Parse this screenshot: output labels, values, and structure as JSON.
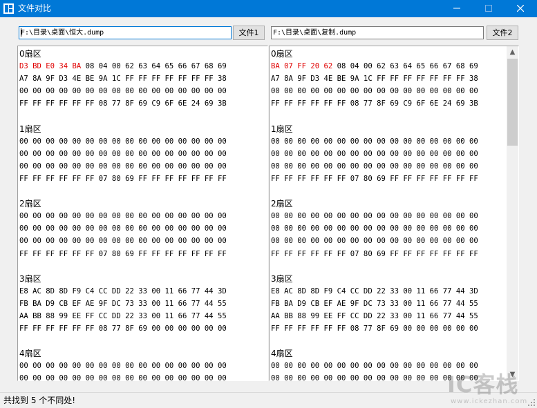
{
  "window": {
    "title": "文件对比",
    "minimize": "—",
    "maximize": "☐",
    "close": "✕"
  },
  "file1": {
    "path": "F:\\目录\\桌面\\恒大.dump",
    "button_label": "文件1"
  },
  "file2": {
    "path": "F:\\目录\\桌面\\复制.dump",
    "button_label": "文件2"
  },
  "left_pane": [
    {
      "text": "0扇区",
      "header": true
    },
    {
      "diff": "D3 BD E0 34 BA",
      "text": " 08 04 00 62 63 64 65 66 67 68 69"
    },
    {
      "text": "A7 8A 9F D3 4E BE 9A 1C FF FF FF FF FF FF FF 38"
    },
    {
      "text": "00 00 00 00 00 00 00 00 00 00 00 00 00 00 00 00"
    },
    {
      "text": "FF FF FF FF FF FF 08 77 8F 69 C9 6F 6E 24 69 3B"
    },
    {
      "text": ""
    },
    {
      "text": "1扇区",
      "header": true
    },
    {
      "text": "00 00 00 00 00 00 00 00 00 00 00 00 00 00 00 00"
    },
    {
      "text": "00 00 00 00 00 00 00 00 00 00 00 00 00 00 00 00"
    },
    {
      "text": "00 00 00 00 00 00 00 00 00 00 00 00 00 00 00 00"
    },
    {
      "text": "FF FF FF FF FF FF 07 80 69 FF FF FF FF FF FF FF"
    },
    {
      "text": ""
    },
    {
      "text": "2扇区",
      "header": true
    },
    {
      "text": "00 00 00 00 00 00 00 00 00 00 00 00 00 00 00 00"
    },
    {
      "text": "00 00 00 00 00 00 00 00 00 00 00 00 00 00 00 00"
    },
    {
      "text": "00 00 00 00 00 00 00 00 00 00 00 00 00 00 00 00"
    },
    {
      "text": "FF FF FF FF FF FF 07 80 69 FF FF FF FF FF FF FF"
    },
    {
      "text": ""
    },
    {
      "text": "3扇区",
      "header": true
    },
    {
      "text": "E8 AC 8D 8D F9 C4 CC DD 22 33 00 11 66 77 44 3D"
    },
    {
      "text": "FB BA D9 CB EF AE 9F DC 73 33 00 11 66 77 44 55"
    },
    {
      "text": "AA BB 88 99 EE FF CC DD 22 33 00 11 66 77 44 55"
    },
    {
      "text": "FF FF FF FF FF FF 08 77 8F 69 00 00 00 00 00 00"
    },
    {
      "text": ""
    },
    {
      "text": "4扇区",
      "header": true
    },
    {
      "text": "00 00 00 00 00 00 00 00 00 00 00 00 00 00 00 00"
    },
    {
      "text": "00 00 00 00 00 00 00 00 00 00 00 00 00 00 00 00"
    }
  ],
  "right_pane": [
    {
      "text": "0扇区",
      "header": true
    },
    {
      "diff": "BA 07 FF 20 62",
      "text": " 08 04 00 62 63 64 65 66 67 68 69"
    },
    {
      "text": "A7 8A 9F D3 4E BE 9A 1C FF FF FF FF FF FF FF 38"
    },
    {
      "text": "00 00 00 00 00 00 00 00 00 00 00 00 00 00 00 00"
    },
    {
      "text": "FF FF FF FF FF FF 08 77 8F 69 C9 6F 6E 24 69 3B"
    },
    {
      "text": ""
    },
    {
      "text": "1扇区",
      "header": true
    },
    {
      "text": "00 00 00 00 00 00 00 00 00 00 00 00 00 00 00 00"
    },
    {
      "text": "00 00 00 00 00 00 00 00 00 00 00 00 00 00 00 00"
    },
    {
      "text": "00 00 00 00 00 00 00 00 00 00 00 00 00 00 00 00"
    },
    {
      "text": "FF FF FF FF FF FF 07 80 69 FF FF FF FF FF FF FF"
    },
    {
      "text": ""
    },
    {
      "text": "2扇区",
      "header": true
    },
    {
      "text": "00 00 00 00 00 00 00 00 00 00 00 00 00 00 00 00"
    },
    {
      "text": "00 00 00 00 00 00 00 00 00 00 00 00 00 00 00 00"
    },
    {
      "text": "00 00 00 00 00 00 00 00 00 00 00 00 00 00 00 00"
    },
    {
      "text": "FF FF FF FF FF FF 07 80 69 FF FF FF FF FF FF FF"
    },
    {
      "text": ""
    },
    {
      "text": "3扇区",
      "header": true
    },
    {
      "text": "E8 AC 8D 8D F9 C4 CC DD 22 33 00 11 66 77 44 3D"
    },
    {
      "text": "FB BA D9 CB EF AE 9F DC 73 33 00 11 66 77 44 55"
    },
    {
      "text": "AA BB 88 99 EE FF CC DD 22 33 00 11 66 77 44 55"
    },
    {
      "text": "FF FF FF FF FF FF 08 77 8F 69 00 00 00 00 00 00"
    },
    {
      "text": ""
    },
    {
      "text": "4扇区",
      "header": true
    },
    {
      "text": "00 00 00 00 00 00 00 00 00 00 00 00 00 00 00 00"
    },
    {
      "text": "00 00 00 00 00 00 00 00 00 00 00 00 00 00 00 00"
    }
  ],
  "scrollbar": {
    "up_arrow": "▲",
    "down_arrow": "▼"
  },
  "status": {
    "text": "共找到 5 个不同处!"
  },
  "watermark": {
    "logo": "IC客栈",
    "url": "www.ickezhan.com"
  },
  "colors": {
    "titlebar": "#0078d7",
    "diff": "#e00000",
    "focus_border": "#0078d7"
  }
}
